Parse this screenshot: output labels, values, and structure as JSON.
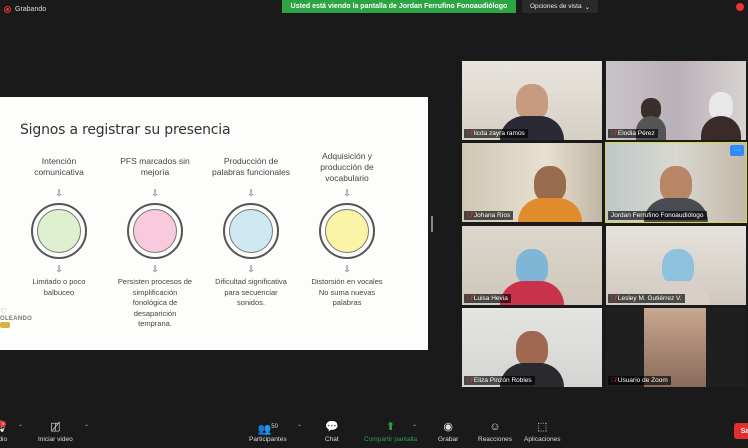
{
  "top": {
    "recording_label": "Grabando",
    "share_banner": "Usted está viendo la pantalla de Jordan Ferrufino Fonoaudiólogo",
    "view_options": "Opciones de vista"
  },
  "slide": {
    "title": "Signos a registrar su presencia",
    "columns": [
      {
        "head": "Intención comunicativa",
        "foot": "Limitado o poco balbuceo",
        "color": "#dff0d0"
      },
      {
        "head": "PFS marcados sin mejoría",
        "foot": "Persisten procesos de simplificación fonológica de desaparición temprana.",
        "color": "#f9c9dd"
      },
      {
        "head": "Producción de palabras funcionales",
        "foot": "Dificultad significativa para secuenciar sonidos.",
        "color": "#cfe9f3"
      },
      {
        "head": "Adquisición y producción de vocabulario",
        "foot": "Distorsión en vocales No suma nuevas palabras",
        "color": "#fbf4a6"
      }
    ],
    "arrow": "⇩",
    "logo_text": "OLEANDO"
  },
  "participants": [
    {
      "name": "licda zayra ramos",
      "muted": true
    },
    {
      "name": "Elodia Pérez",
      "muted": true
    },
    {
      "name": "Johana Ríos",
      "muted": true
    },
    {
      "name": "Jordan Ferrufino Fonoaudiólogo",
      "muted": false,
      "active": true
    },
    {
      "name": "Luisa Hevia",
      "muted": true
    },
    {
      "name": "Lesley M. Gutiérrez V.",
      "muted": true
    },
    {
      "name": "Eliza Pinzón Robles",
      "muted": true
    },
    {
      "name": "Usuario de Zoom",
      "muted": true
    }
  ],
  "toolbar": {
    "audio_label": "udio",
    "video_label": "Iniciar video",
    "participants_label": "Participantes",
    "participants_count": "50",
    "chat_label": "Chat",
    "share_label": "Compartir pantalla",
    "record_label": "Grabar",
    "reactions_label": "Reacciones",
    "apps_label": "Aplicaciones",
    "end_label": "Sa",
    "mic_badge": "4"
  },
  "colors": {
    "share_green": "#2ca443",
    "active_border": "#d6d84a",
    "end_red": "#e02f2f"
  }
}
